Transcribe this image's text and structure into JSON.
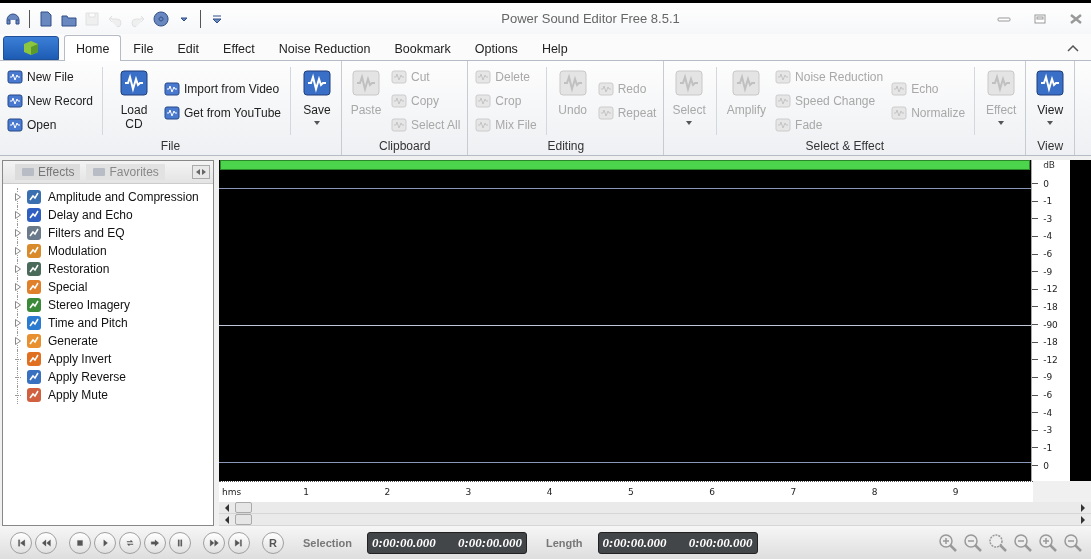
{
  "window": {
    "title": "Power Sound Editor Free 8.5.1"
  },
  "quick_access": [
    {
      "kind": "headset",
      "disabled": false
    },
    {
      "kind": "separator"
    },
    {
      "kind": "new",
      "disabled": false
    },
    {
      "kind": "open",
      "disabled": false
    },
    {
      "kind": "save",
      "disabled": true
    },
    {
      "kind": "undo",
      "disabled": true
    },
    {
      "kind": "redo",
      "disabled": true
    },
    {
      "kind": "disc",
      "disabled": false
    },
    {
      "kind": "caret",
      "disabled": false
    },
    {
      "kind": "separator"
    },
    {
      "kind": "customize",
      "disabled": false
    }
  ],
  "tabs": [
    {
      "label": "Home",
      "selected": true
    },
    {
      "label": "File",
      "selected": false
    },
    {
      "label": "Edit",
      "selected": false
    },
    {
      "label": "Effect",
      "selected": false
    },
    {
      "label": "Noise Reduction",
      "selected": false
    },
    {
      "label": "Bookmark",
      "selected": false
    },
    {
      "label": "Options",
      "selected": false
    },
    {
      "label": "Help",
      "selected": false
    }
  ],
  "ribbon": {
    "groups": [
      {
        "label": "File",
        "columns": [
          {
            "kind": "stack",
            "items": [
              {
                "label": "New File",
                "disabled": false
              },
              {
                "label": "New Record",
                "disabled": false
              },
              {
                "label": "Open",
                "disabled": false
              }
            ]
          },
          {
            "kind": "separator"
          },
          {
            "kind": "large",
            "label": "Load CD",
            "disabled": false,
            "menu": false
          },
          {
            "kind": "stack",
            "items": [
              {
                "label": "Import from Video",
                "disabled": false
              },
              {
                "label": "Get from YouTube",
                "disabled": false
              }
            ]
          },
          {
            "kind": "separator"
          },
          {
            "kind": "large",
            "label": "Save",
            "disabled": false,
            "menu": true
          }
        ]
      },
      {
        "label": "Clipboard",
        "columns": [
          {
            "kind": "large",
            "label": "Paste",
            "disabled": true,
            "menu": false
          },
          {
            "kind": "stack",
            "items": [
              {
                "label": "Cut",
                "disabled": true
              },
              {
                "label": "Copy",
                "disabled": true
              },
              {
                "label": "Select All",
                "disabled": true
              }
            ]
          }
        ]
      },
      {
        "label": "Editing",
        "columns": [
          {
            "kind": "stack",
            "items": [
              {
                "label": "Delete",
                "disabled": true
              },
              {
                "label": "Crop",
                "disabled": true
              },
              {
                "label": "Mix File",
                "disabled": true
              }
            ]
          },
          {
            "kind": "separator"
          },
          {
            "kind": "large",
            "label": "Undo",
            "disabled": true,
            "menu": false
          },
          {
            "kind": "stack",
            "items": [
              {
                "label": "Redo",
                "disabled": true
              },
              {
                "label": "Repeat",
                "disabled": true
              }
            ]
          }
        ]
      },
      {
        "label": "Select & Effect",
        "columns": [
          {
            "kind": "large",
            "label": "Select",
            "disabled": true,
            "menu": true
          },
          {
            "kind": "separator"
          },
          {
            "kind": "large",
            "label": "Amplify",
            "disabled": true,
            "menu": false
          },
          {
            "kind": "stack",
            "items": [
              {
                "label": "Noise Reduction",
                "disabled": true
              },
              {
                "label": "Speed Change",
                "disabled": true
              },
              {
                "label": "Fade",
                "disabled": true
              }
            ]
          },
          {
            "kind": "stack",
            "items": [
              {
                "label": "Echo",
                "disabled": true
              },
              {
                "label": "Normalize",
                "disabled": true
              }
            ]
          },
          {
            "kind": "separator"
          },
          {
            "kind": "large",
            "label": "Effect",
            "disabled": true,
            "menu": true
          }
        ]
      },
      {
        "label": "View",
        "columns": [
          {
            "kind": "large",
            "label": "View",
            "disabled": false,
            "menu": true
          }
        ]
      }
    ]
  },
  "sidebar": {
    "tabs": [
      {
        "label": "Effects",
        "selected": true
      },
      {
        "label": "Favorites",
        "selected": false
      }
    ],
    "items": [
      {
        "label": "Amplitude and Compression",
        "expandable": true,
        "color": "#3a6fb0"
      },
      {
        "label": "Delay and Echo",
        "expandable": true,
        "color": "#2f5fc0"
      },
      {
        "label": "Filters and EQ",
        "expandable": true,
        "color": "#6a7a8a"
      },
      {
        "label": "Modulation",
        "expandable": true,
        "color": "#d98a2b"
      },
      {
        "label": "Restoration",
        "expandable": true,
        "color": "#4a6a5a"
      },
      {
        "label": "Special",
        "expandable": true,
        "color": "#e0802a"
      },
      {
        "label": "Stereo Imagery",
        "expandable": true,
        "color": "#3a8a3a"
      },
      {
        "label": "Time and Pitch",
        "expandable": true,
        "color": "#2a7ad0"
      },
      {
        "label": "Generate",
        "expandable": true,
        "color": "#e89030"
      },
      {
        "label": "Apply Invert",
        "expandable": false,
        "color": "#e07020"
      },
      {
        "label": "Apply Reverse",
        "expandable": false,
        "color": "#3a70c0"
      },
      {
        "label": "Apply Mute",
        "expandable": false,
        "color": "#d06040"
      }
    ]
  },
  "db_scale": {
    "unit": "dB",
    "labels": [
      "0",
      "-1",
      "-3",
      "-4",
      "-6",
      "-9",
      "-12",
      "-18",
      "-90",
      "-18",
      "-12",
      "-9",
      "-6",
      "-4",
      "-3",
      "-1",
      "0"
    ]
  },
  "time_ruler": {
    "labels": [
      "hms",
      "1",
      "2",
      "3",
      "4",
      "5",
      "6",
      "7",
      "8",
      "9"
    ]
  },
  "transport": [
    {
      "kind": "first"
    },
    {
      "kind": "rewind"
    },
    {
      "kind": "stop"
    },
    {
      "kind": "play"
    },
    {
      "kind": "loop"
    },
    {
      "kind": "play-arrow"
    },
    {
      "kind": "pause"
    },
    {
      "kind": "forward"
    },
    {
      "kind": "last"
    },
    {
      "kind": "record",
      "label": "R"
    }
  ],
  "selection": {
    "label": "Selection",
    "start": "0:00:00.000",
    "end": "0:00:00.000"
  },
  "length": {
    "label": "Length",
    "start": "0:00:00.000",
    "end": "0:00:00.000"
  },
  "zoom_tools": [
    {
      "kind": "in"
    },
    {
      "kind": "out"
    },
    {
      "kind": "selection"
    },
    {
      "kind": "out"
    },
    {
      "kind": "in"
    },
    {
      "kind": "out"
    }
  ]
}
